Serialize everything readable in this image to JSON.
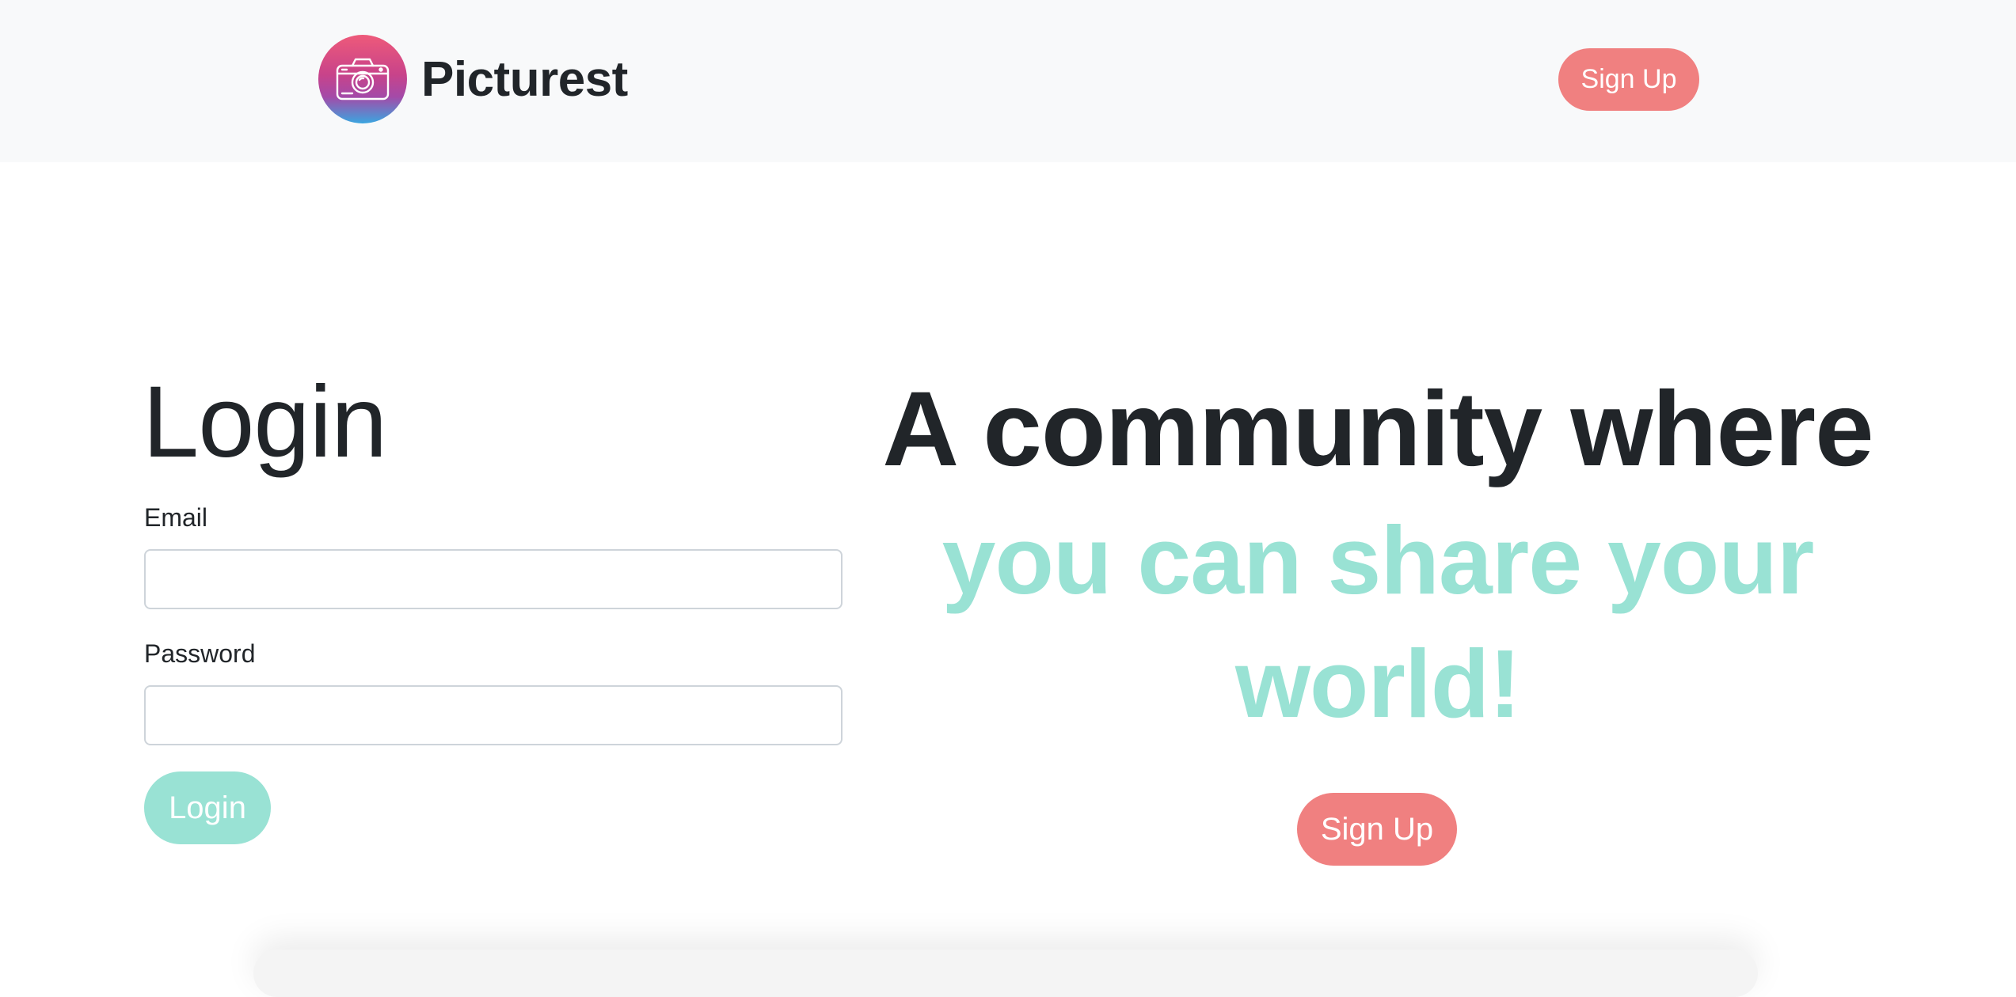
{
  "navbar": {
    "brand_name": "Picturest",
    "logo_icon": "camera-icon",
    "signup_label": "Sign Up"
  },
  "login": {
    "title": "Login",
    "email_label": "Email",
    "email_value": "",
    "password_label": "Password",
    "password_value": "",
    "button_label": "Login"
  },
  "hero": {
    "headline": "A community where",
    "subheadline": "you can share your world!",
    "signup_label": "Sign Up"
  },
  "colors": {
    "accent_teal": "#99e2d4",
    "accent_coral": "#f08080",
    "navbar_bg": "#f8f9fa",
    "text_dark": "#212529"
  }
}
